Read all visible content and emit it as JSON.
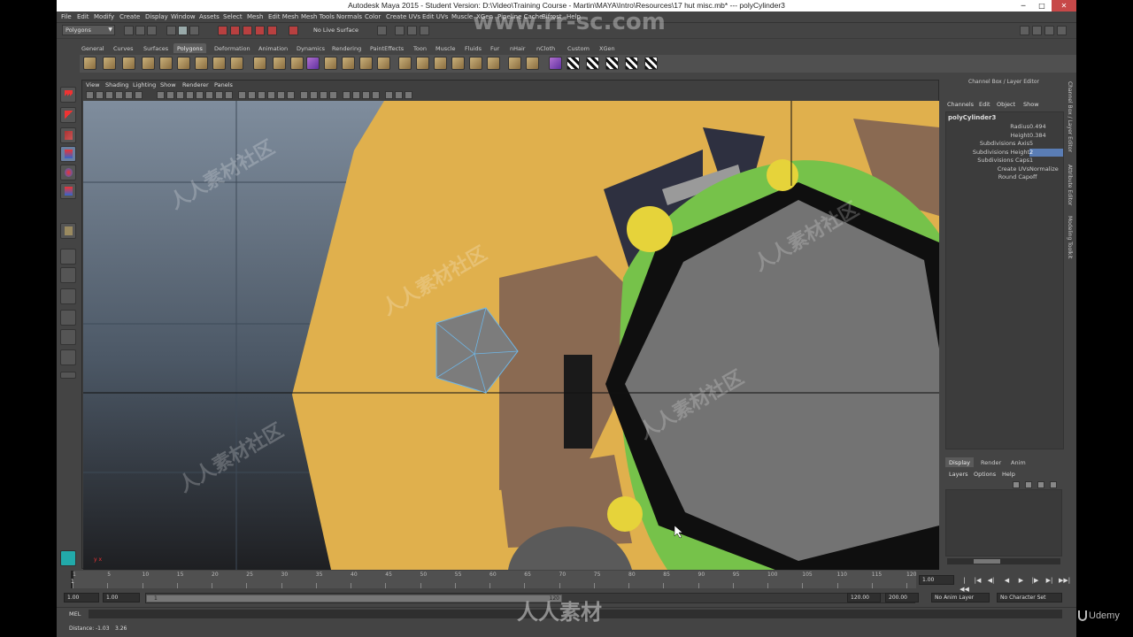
{
  "window": {
    "title": "Autodesk Maya 2015 - Student Version: D:\\Video\\Training Course - Martin\\MAYA\\Intro\\Resources\\17 hut misc.mb*   ---   polyCylinder3",
    "min_icon": "─",
    "max_icon": "□",
    "close_icon": "✕"
  },
  "menu": [
    "File",
    "Edit",
    "Modify",
    "Create",
    "Display",
    "Window",
    "Assets",
    "Select",
    "Mesh",
    "Edit Mesh",
    "Mesh Tools",
    "Normals",
    "Color",
    "Create UVs",
    "Edit UVs",
    "Muscle",
    "XGen",
    "Pipeline Cache",
    "Bifrost",
    "Help"
  ],
  "status_line": {
    "mode": "Polygons",
    "live_surface": "No Live Surface"
  },
  "shelf": {
    "tabs": [
      "General",
      "Curves",
      "Surfaces",
      "Polygons",
      "Deformation",
      "Animation",
      "Dynamics",
      "Rendering",
      "PaintEffects",
      "Toon",
      "Muscle",
      "Fluids",
      "Fur",
      "nHair",
      "nCloth",
      "Custom",
      "XGen"
    ],
    "active_tab": "Polygons"
  },
  "viewport": {
    "menu": [
      "View",
      "Shading",
      "Lighting",
      "Show",
      "Renderer",
      "Panels"
    ],
    "axis_label": "y x"
  },
  "channel_box": {
    "title": "Channel Box / Layer Editor",
    "menu": [
      "Channels",
      "Edit",
      "Object",
      "Show"
    ],
    "node": "polyCylinder3",
    "attributes": [
      {
        "name": "Radius",
        "value": "0.494"
      },
      {
        "name": "Height",
        "value": "0.384"
      },
      {
        "name": "Subdivisions Axis",
        "value": "5"
      },
      {
        "name": "Subdivisions Height",
        "value": "2",
        "highlight": true
      },
      {
        "name": "Subdivisions Caps",
        "value": "1"
      },
      {
        "name": "Create UVs",
        "value": "Normalize ..."
      },
      {
        "name": "Round Cap",
        "value": "off"
      }
    ]
  },
  "side_tabs": [
    "Channel Box / Layer Editor",
    "Attribute Editor",
    "Modeling Toolkit"
  ],
  "layer_editor": {
    "tabs": [
      "Display",
      "Render",
      "Anim"
    ],
    "active_tab": "Display",
    "menu": [
      "Layers",
      "Options",
      "Help"
    ]
  },
  "time_slider": {
    "ticks": [
      "1",
      "5",
      "10",
      "15",
      "20",
      "25",
      "30",
      "35",
      "40",
      "45",
      "50",
      "55",
      "60",
      "65",
      "70",
      "75",
      "80",
      "85",
      "90",
      "95",
      "100",
      "105",
      "110",
      "115",
      "120"
    ],
    "current_frame": "1",
    "current_time_field": "1.00"
  },
  "playback": [
    "|◀◀",
    "|◀",
    "◀|",
    "◀",
    "▶",
    "|▶",
    "▶|",
    "▶▶|"
  ],
  "range": {
    "start": "1.00",
    "playback_start": "1.00",
    "range_start_label": "1",
    "range_end_label": "120",
    "playback_end": "120.00",
    "end": "200.00",
    "anim_layer": "No Anim Layer",
    "char_set": "No Character Set"
  },
  "command_line": {
    "label": "MEL"
  },
  "help_line": {
    "label": "Distance:",
    "v1": "-1.03",
    "v2": "3.26"
  },
  "watermarks": {
    "site": "www.rr-sc.com",
    "brand": "人人素材",
    "repeat": "人人素材社区"
  },
  "udemy": "Udemy"
}
